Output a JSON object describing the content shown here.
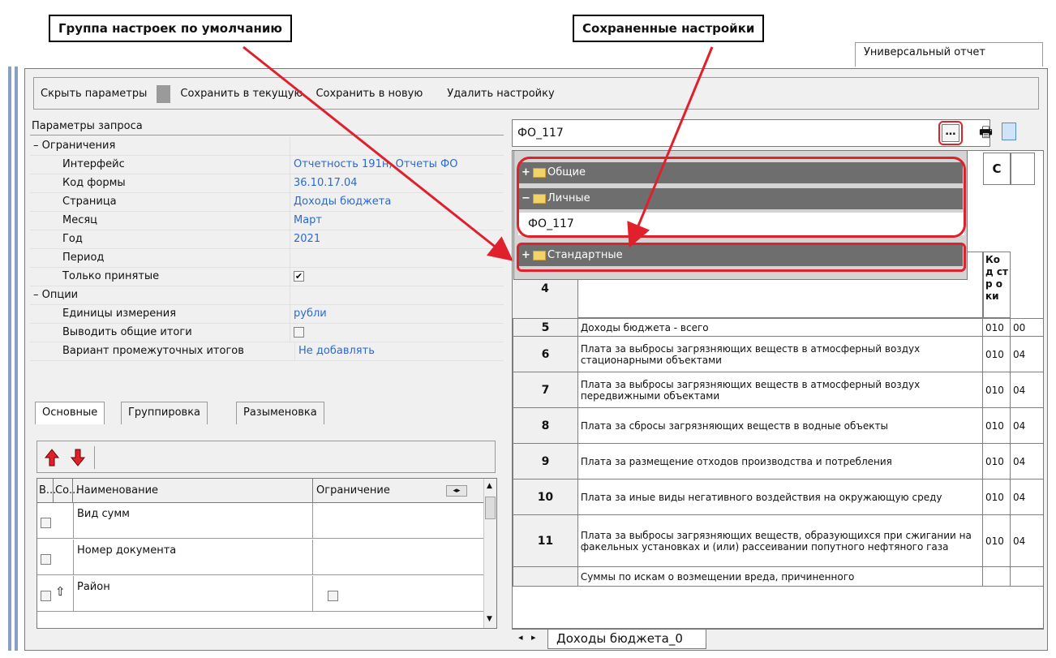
{
  "callouts": {
    "default_group": "Группа настроек по умолчанию",
    "saved": "Сохраненные настройки"
  },
  "window_tab": "Универсальный отчет",
  "toolbar": {
    "hide": "Скрыть параметры",
    "save_current": "Сохранить в текущую",
    "save_new": "Сохранить в новую",
    "delete": "Удалить настройку"
  },
  "params": {
    "title": "Параметры запроса",
    "rows": [
      {
        "label": "– Ограничения",
        "value": ""
      },
      {
        "label": "Интерфейс",
        "value": "Отчетность 191н, Отчеты ФО"
      },
      {
        "label": "Код формы",
        "value": "36.10.17.04"
      },
      {
        "label": "Страница",
        "value": "Доходы бюджета"
      },
      {
        "label": "Месяц",
        "value": "Март"
      },
      {
        "label": "Год",
        "value": "2021"
      },
      {
        "label": "Период",
        "value": ""
      },
      {
        "label": "Только принятые",
        "value": ""
      },
      {
        "label": "– Опции",
        "value": ""
      },
      {
        "label": "Единицы измерения",
        "value": "рубли"
      },
      {
        "label": "Выводить общие итоги",
        "value": ""
      },
      {
        "label": "Вариант промежуточных итогов",
        "value": "Не добавлять"
      }
    ],
    "only_accepted_checked": true,
    "show_totals_checked": false
  },
  "lower_tabs": {
    "main": "Основные",
    "grouping": "Группировка",
    "rename": "Разыменовка"
  },
  "grid": {
    "headers": {
      "c1": "В...",
      "c2": "Со...",
      "name": "Наименование",
      "limit": "Ограничение"
    },
    "rows": [
      {
        "name": "Вид сумм"
      },
      {
        "name": "Номер документа"
      },
      {
        "name": "Район"
      }
    ]
  },
  "setting_select": {
    "value": "ФО_117"
  },
  "tree": {
    "general": "Общие",
    "personal": "Личные",
    "personal_item": "ФО_117",
    "standard": "Стандартные"
  },
  "report": {
    "col_c": "С",
    "col_code_header": "Ко д стр оки",
    "row4": "4",
    "rows": [
      {
        "num": "5",
        "text": "Доходы бюджета - всего",
        "code": "010",
        "v": "00"
      },
      {
        "num": "6",
        "text": "Плата за выбросы загрязняющих веществ в атмосферный воздух стационарными объектами",
        "code": "010",
        "v": "04"
      },
      {
        "num": "7",
        "text": "Плата за выбросы загрязняющих веществ в атмосферный воздух передвижными объектами",
        "code": "010",
        "v": "04"
      },
      {
        "num": "8",
        "text": "Плата за сбросы загрязняющих веществ в водные объекты",
        "code": "010",
        "v": "04"
      },
      {
        "num": "9",
        "text": "Плата за размещение отходов производства и потребления",
        "code": "010",
        "v": "04"
      },
      {
        "num": "10",
        "text": "Плата за иные виды негативного воздействия на окружающую среду",
        "code": "010",
        "v": "04"
      },
      {
        "num": "11",
        "text": "Плата за выбросы загрязняющих веществ, образующихся при сжигании на факельных установках и (или) рассеивании попутного нефтяного газа",
        "code": "010",
        "v": "04"
      },
      {
        "num": "",
        "text": "Суммы по искам о возмещении вреда, причиненного",
        "code": "",
        "v": ""
      }
    ],
    "sheet_tab": "Доходы бюджета_0"
  },
  "colors": {
    "annotation": "#e0202a",
    "link": "#2a6ad0",
    "tree_bg": "#6e6e6e"
  }
}
